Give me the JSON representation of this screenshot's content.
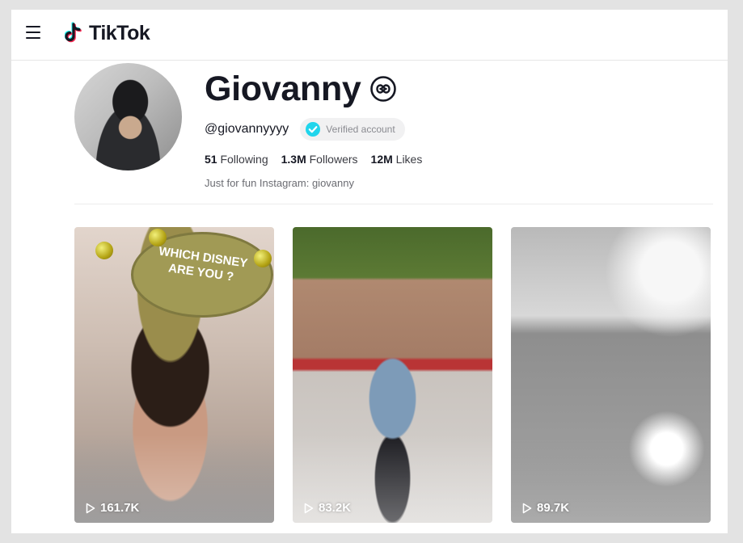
{
  "header": {
    "logo_text": "TikTok"
  },
  "profile": {
    "display_name": "Giovanny",
    "handle": "@giovannyyyy",
    "verified_label": "Verified account",
    "stats": [
      {
        "value": "51",
        "label": "Following"
      },
      {
        "value": "1.3M",
        "label": "Followers"
      },
      {
        "value": "12M",
        "label": "Likes"
      }
    ],
    "bio": "Just for fun Instagram: giovanny"
  },
  "videos": [
    {
      "views": "161.7K",
      "sticker_text": "WHICH DISNEY ARE YOU ?"
    },
    {
      "views": "83.2K"
    },
    {
      "views": "89.7K"
    }
  ],
  "colors": {
    "brand_text": "#161823",
    "verified_badge": "#20d5ec",
    "logo_cyan": "#25f4ee",
    "logo_red": "#fe2c55"
  },
  "icons": [
    "hamburger-menu-icon",
    "tiktok-logo-icon",
    "infinity-icon",
    "verified-check-icon",
    "play-icon"
  ]
}
